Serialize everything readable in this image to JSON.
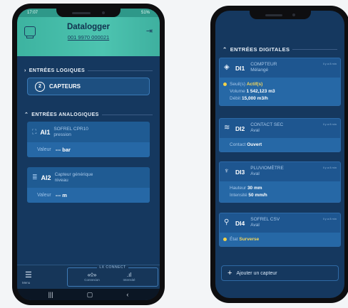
{
  "phone1": {
    "status": {
      "time": "17:07",
      "battery": "51%"
    },
    "header": {
      "title": "Datalogger",
      "subtitle": "001 9970 000021"
    },
    "entrees_logiques": {
      "label": "ENTRÉES LOGIQUES"
    },
    "capteurs": {
      "count": "2",
      "label": "CAPTEURS"
    },
    "entrees_analogiques": {
      "label": "ENTRÉES ANALOGIQUES"
    },
    "cards": [
      {
        "id": "AI1",
        "line1": "SOFREL CPR10",
        "line2": "pression",
        "value_label": "Valeur",
        "value": "--- bar"
      },
      {
        "id": "AI2",
        "line1": "Capteur générique",
        "line2": "niveau",
        "value_label": "Valeur",
        "value": "--- m"
      }
    ],
    "nav": {
      "menu_label": "Menu",
      "lx_title": "LX CONNECT",
      "items": [
        {
          "icon": "connection-icon",
          "glyph": "«◊»",
          "label": "Connexion"
        },
        {
          "icon": "signal-icon",
          "glyph": ".ıl",
          "label": "Intensité"
        }
      ]
    }
  },
  "phone2": {
    "section": {
      "label": "ENTRÉES DIGITALES"
    },
    "cards": [
      {
        "id": "DI1",
        "icon": "meter-icon",
        "glyph": "◈",
        "line1": "COMPTEUR",
        "line2": "Mélangé",
        "time": "Il y a 8 min",
        "rows": [
          {
            "label": "Seuil(s)",
            "value": "Actif(s)",
            "dot": true
          },
          {
            "label": "Volume",
            "value": "1 542,123 m3"
          },
          {
            "label": "Débit",
            "value": "15,000 m3/h"
          }
        ]
      },
      {
        "id": "DI2",
        "icon": "contact-icon",
        "glyph": "≋",
        "line1": "CONTACT SEC",
        "line2": "Aval",
        "time": "Il y a 8 min",
        "rows": [
          {
            "label": "Contact",
            "value": "Ouvert"
          }
        ]
      },
      {
        "id": "DI3",
        "icon": "rain-gauge-icon",
        "glyph": "♆",
        "line1": "PLUVIOMÈTRE",
        "line2": "Aval",
        "time": "Il y a 8 min",
        "rows": [
          {
            "label": "Hauteur",
            "value": "30 mm"
          },
          {
            "label": "Intensité",
            "value": "50 mm/h"
          }
        ]
      },
      {
        "id": "DI4",
        "icon": "overflow-icon",
        "glyph": "⚲",
        "line1": "SOFREL CSV",
        "line2": "Aval",
        "time": "Il y a 8 min",
        "rows": [
          {
            "label": "État",
            "value": "Surverse",
            "dot": true
          }
        ]
      }
    ],
    "add_label": "Ajouter un capteur"
  }
}
